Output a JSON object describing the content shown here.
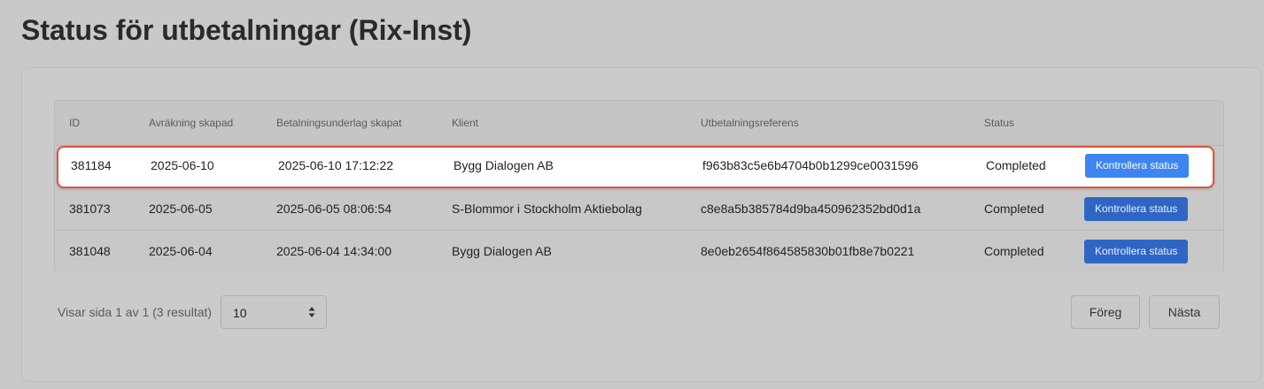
{
  "page": {
    "title": "Status för utbetalningar (Rix-Inst)"
  },
  "table": {
    "columns": [
      "ID",
      "Avräkning skapad",
      "Betalningsunderlag skapat",
      "Klient",
      "Utbetalningsreferens",
      "Status"
    ],
    "rows": [
      {
        "id": "381184",
        "settlement_created": "2025-06-10",
        "payment_basis_created": "2025-06-10 17:12:22",
        "client": "Bygg Dialogen AB",
        "reference": "f963b83c5e6b4704b0b1299ce0031596",
        "status": "Completed",
        "action": "Kontrollera status",
        "highlighted": true
      },
      {
        "id": "381073",
        "settlement_created": "2025-06-05",
        "payment_basis_created": "2025-06-05 08:06:54",
        "client": "S-Blommor i Stockholm Aktiebolag",
        "reference": "c8e8a5b385784d9ba450962352bd0d1a",
        "status": "Completed",
        "action": "Kontrollera status",
        "highlighted": false
      },
      {
        "id": "381048",
        "settlement_created": "2025-06-04",
        "payment_basis_created": "2025-06-04 14:34:00",
        "client": "Bygg Dialogen AB",
        "reference": "8e0eb2654f864585830b01fb8e7b0221",
        "status": "Completed",
        "action": "Kontrollera status",
        "highlighted": false
      }
    ]
  },
  "pagination": {
    "summary": "Visar sida 1 av 1 (3 resultat)",
    "page_size": "10",
    "prev_label": "Föreg",
    "next_label": "Nästa"
  },
  "colors": {
    "primary_button": "#2f66c4",
    "primary_button_active": "#3d85f0",
    "highlight_border": "#e0533a"
  },
  "icons": {
    "page_size_select": "sort-arrows-icon"
  }
}
